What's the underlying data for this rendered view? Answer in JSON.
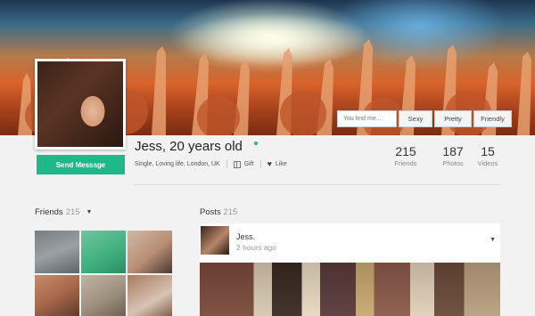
{
  "profile": {
    "name": "Jess, 20 years old",
    "subtitle": "Single, Loving life, London, UK",
    "gift_label": "Gift",
    "like_label": "Like",
    "send_message_label": "Send Message"
  },
  "search": {
    "placeholder": "You find me...",
    "chips": [
      "Sexy",
      "Pretty",
      "Friendly"
    ]
  },
  "stats": {
    "friends": {
      "value": "215",
      "label": "Friends"
    },
    "photos": {
      "value": "187",
      "label": "Photos"
    },
    "videos": {
      "value": "15",
      "label": "Videos"
    }
  },
  "friends_section": {
    "title": "Friends",
    "count": "215"
  },
  "posts_section": {
    "title": "Posts",
    "count": "215"
  },
  "post": {
    "author": "Jess.",
    "time": "2 hours ago"
  },
  "colors": {
    "accent": "#1fb88a"
  },
  "icons": {
    "gift": "gift-icon",
    "like": "heart-icon",
    "dropdown": "chevron-down-icon"
  }
}
